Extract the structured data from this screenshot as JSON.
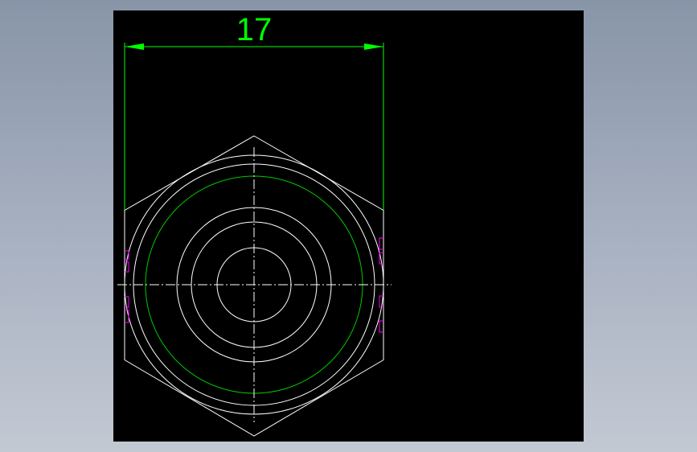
{
  "drawing": {
    "dimension_text": "17",
    "colors": {
      "canvas_background": "#000000",
      "app_background": "#98a2b3",
      "geometry": "#ffffff",
      "dimension": "#00ff00",
      "thread_circle": "#00c800",
      "hidden_marks": "#ff00ff"
    }
  }
}
